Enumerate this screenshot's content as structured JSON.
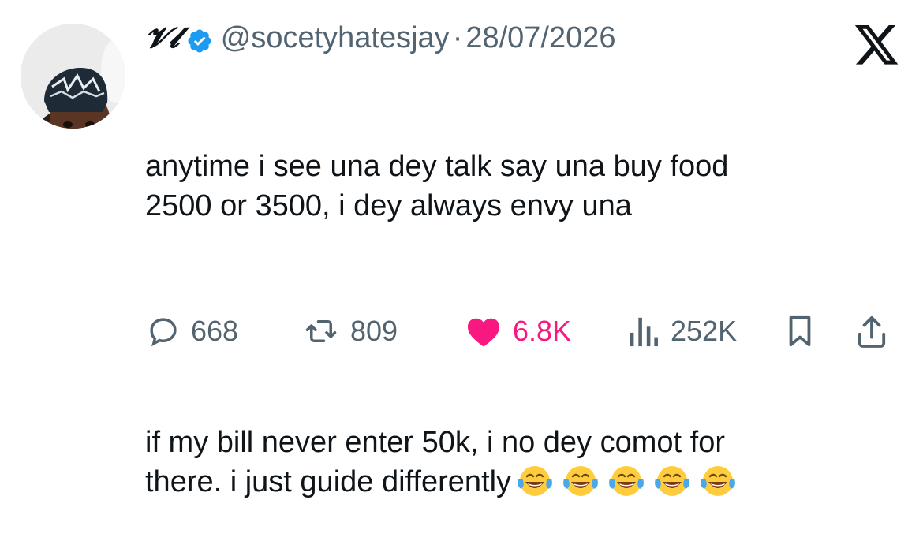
{
  "author": {
    "display_name": "𝓥𝓵",
    "handle": "@socetyhatesjay",
    "separator": "·",
    "date": "28/07/2026",
    "verified": true
  },
  "tweet": {
    "paragraph_1": "anytime i see una dey talk say una buy food\n2500 or 3500, i dey always envy una",
    "paragraph_2": "if my bill never enter 50k, i no dey comot for\nthere. i just guide differently",
    "emojis": [
      "face-with-tears-of-joy",
      "face-with-tears-of-joy",
      "face-with-tears-of-joy",
      "face-with-tears-of-joy",
      "face-with-tears-of-joy"
    ]
  },
  "actions": {
    "replies": "668",
    "retweets": "809",
    "likes": "6.8K",
    "views": "252K"
  },
  "colors": {
    "text": "#0f1419",
    "secondary": "#536471",
    "verified_blue": "#1d9bf0",
    "like_pink": "#f91880"
  },
  "icons": [
    "avatar-photo",
    "verified-badge-icon",
    "x-logo-icon",
    "reply-icon",
    "retweet-icon",
    "heart-icon",
    "views-icon",
    "bookmark-icon",
    "share-icon"
  ]
}
